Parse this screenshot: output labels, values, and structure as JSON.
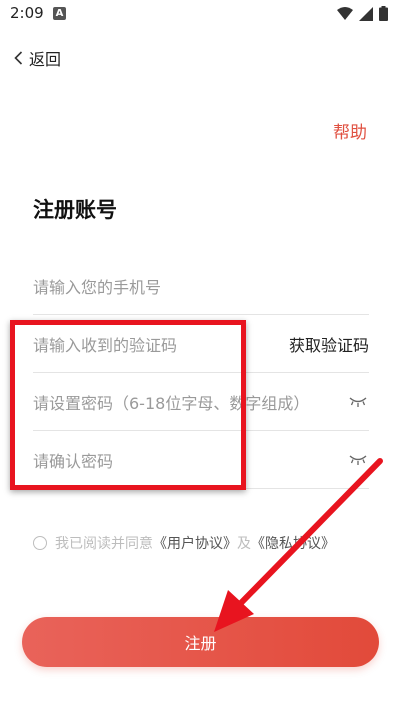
{
  "status_bar": {
    "time": "2:09",
    "notification_letter": "A"
  },
  "nav": {
    "back_label": "返回",
    "help_label": "帮助"
  },
  "page": {
    "title": "注册账号"
  },
  "form": {
    "phone_placeholder": "请输入您的手机号",
    "code_placeholder": "请输入收到的验证码",
    "get_code_label": "获取验证码",
    "password_placeholder": "请设置密码（6-18位字母、数字组成）",
    "confirm_placeholder": "请确认密码"
  },
  "agreement": {
    "prefix": "我已阅读并同意",
    "user_agreement": "《用户协议》",
    "and": "及",
    "privacy_policy": "《隐私协议》"
  },
  "actions": {
    "register_label": "注册"
  },
  "colors": {
    "accent": "#e24a3a",
    "annotation": "#e8141f"
  }
}
